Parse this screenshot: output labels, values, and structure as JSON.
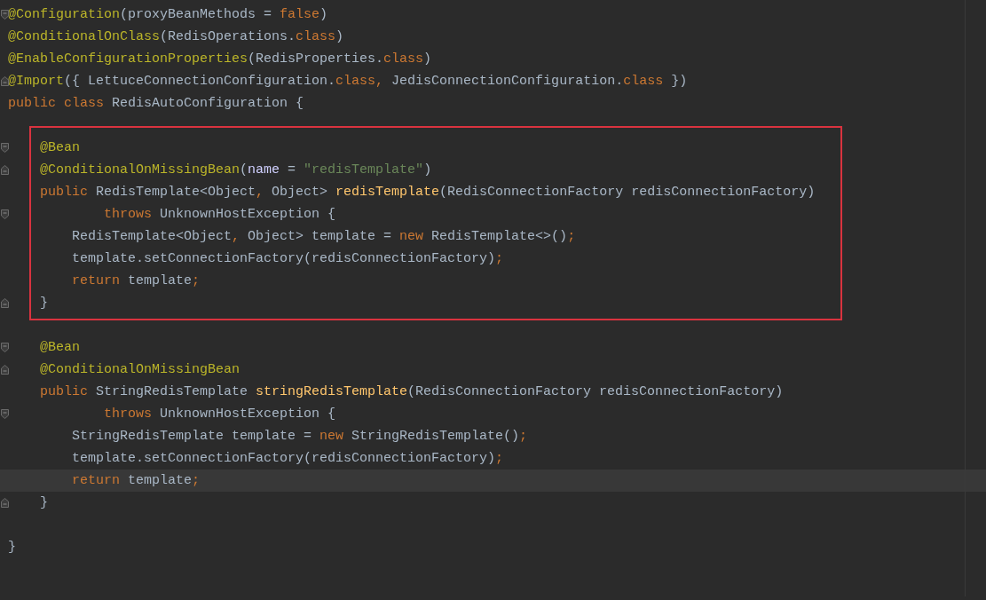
{
  "editor": {
    "lines": [
      {
        "kind": "code",
        "current": false,
        "fold": {
          "kind": "open"
        },
        "tokens": [
          {
            "kind": "annotation",
            "text": "@Configuration"
          },
          {
            "kind": "plain",
            "text": "(proxyBeanMethods = "
          },
          {
            "kind": "keyword",
            "text": "false"
          },
          {
            "kind": "plain",
            "text": ")"
          }
        ]
      },
      {
        "kind": "code",
        "current": false,
        "tokens": [
          {
            "kind": "annotation",
            "text": "@ConditionalOnClass"
          },
          {
            "kind": "plain",
            "text": "(RedisOperations."
          },
          {
            "kind": "keyword",
            "text": "class"
          },
          {
            "kind": "plain",
            "text": ")"
          }
        ]
      },
      {
        "kind": "code",
        "current": false,
        "tokens": [
          {
            "kind": "annotation",
            "text": "@EnableConfigurationProperties"
          },
          {
            "kind": "plain",
            "text": "(RedisProperties."
          },
          {
            "kind": "keyword",
            "text": "class"
          },
          {
            "kind": "plain",
            "text": ")"
          }
        ]
      },
      {
        "kind": "code",
        "current": false,
        "fold": {
          "kind": "close"
        },
        "tokens": [
          {
            "kind": "annotation",
            "text": "@Import"
          },
          {
            "kind": "plain",
            "text": "({ LettuceConnectionConfiguration."
          },
          {
            "kind": "keyword",
            "text": "class,"
          },
          {
            "kind": "plain",
            "text": " JedisConnectionConfiguration."
          },
          {
            "kind": "keyword",
            "text": "class"
          },
          {
            "kind": "plain",
            "text": " })"
          }
        ]
      },
      {
        "kind": "code",
        "current": false,
        "tokens": [
          {
            "kind": "keyword",
            "text": "public class "
          },
          {
            "kind": "plain",
            "text": "RedisAutoConfiguration {"
          }
        ],
        "children": [
          {
            "kind": "highlight",
            "children": [
              {
                "kind": "code",
                "current": false,
                "fold": {
                  "kind": "open"
                },
                "tokens": [
                  {
                    "kind": "annotation",
                    "text": "@Bean"
                  }
                ]
              },
              {
                "kind": "code",
                "current": false,
                "fold": {
                  "kind": "close"
                },
                "tokens": [
                  {
                    "kind": "annotation",
                    "text": "@ConditionalOnMissingBean"
                  },
                  {
                    "kind": "plain",
                    "text": "("
                  },
                  {
                    "kind": "param",
                    "text": "name"
                  },
                  {
                    "kind": "plain",
                    "text": " = "
                  },
                  {
                    "kind": "string",
                    "text": "\"redisTemplate\""
                  },
                  {
                    "kind": "plain",
                    "text": ")"
                  }
                ]
              },
              {
                "kind": "code",
                "current": false,
                "tokens": [
                  {
                    "kind": "keyword",
                    "text": "public "
                  },
                  {
                    "kind": "plain",
                    "text": "RedisTemplate<Object"
                  },
                  {
                    "kind": "keyword",
                    "text": ","
                  },
                  {
                    "kind": "plain",
                    "text": " Object> "
                  },
                  {
                    "kind": "method",
                    "text": "redisTemplate"
                  },
                  {
                    "kind": "plain",
                    "text": "(RedisConnectionFactory redisConnectionFactory)"
                  }
                ],
                "children": [
                  {
                    "kind": "continuation",
                    "current": false,
                    "fold": {
                      "kind": "open"
                    },
                    "tokens": [
                      {
                        "kind": "keyword",
                        "text": "throws "
                      },
                      {
                        "kind": "plain",
                        "text": "UnknownHostException {"
                      }
                    ]
                  },
                  {
                    "kind": "code",
                    "current": false,
                    "tokens": [
                      {
                        "kind": "plain",
                        "text": "RedisTemplate<Object"
                      },
                      {
                        "kind": "keyword",
                        "text": ","
                      },
                      {
                        "kind": "plain",
                        "text": " Object> template = "
                      },
                      {
                        "kind": "keyword",
                        "text": "new "
                      },
                      {
                        "kind": "plain",
                        "text": "RedisTemplate<>()"
                      },
                      {
                        "kind": "keyword",
                        "text": ";"
                      }
                    ]
                  },
                  {
                    "kind": "code",
                    "current": false,
                    "tokens": [
                      {
                        "kind": "plain",
                        "text": "template.setConnectionFactory(redisConnectionFactory)"
                      },
                      {
                        "kind": "keyword",
                        "text": ";"
                      }
                    ]
                  },
                  {
                    "kind": "code",
                    "current": false,
                    "tokens": [
                      {
                        "kind": "keyword",
                        "text": "return "
                      },
                      {
                        "kind": "plain",
                        "text": "template"
                      },
                      {
                        "kind": "keyword",
                        "text": ";"
                      }
                    ]
                  }
                ]
              },
              {
                "kind": "code",
                "current": false,
                "fold": {
                  "kind": "close"
                },
                "tokens": [
                  {
                    "kind": "plain",
                    "text": "}"
                  }
                ]
              }
            ]
          },
          {
            "kind": "code",
            "current": false,
            "fold": {
              "kind": "open"
            },
            "tokens": [
              {
                "kind": "annotation",
                "text": "@Bean"
              }
            ]
          },
          {
            "kind": "code",
            "current": false,
            "fold": {
              "kind": "close"
            },
            "tokens": [
              {
                "kind": "annotation",
                "text": "@ConditionalOnMissingBean"
              }
            ]
          },
          {
            "kind": "code",
            "current": false,
            "tokens": [
              {
                "kind": "keyword",
                "text": "public "
              },
              {
                "kind": "plain",
                "text": "StringRedisTemplate "
              },
              {
                "kind": "method",
                "text": "stringRedisTemplate"
              },
              {
                "kind": "plain",
                "text": "(RedisConnectionFactory redisConnectionFactory)"
              }
            ],
            "children": [
              {
                "kind": "continuation",
                "current": false,
                "fold": {
                  "kind": "open"
                },
                "tokens": [
                  {
                    "kind": "keyword",
                    "text": "throws "
                  },
                  {
                    "kind": "plain",
                    "text": "UnknownHostException {"
                  }
                ]
              },
              {
                "kind": "code",
                "current": false,
                "tokens": [
                  {
                    "kind": "plain",
                    "text": "StringRedisTemplate template = "
                  },
                  {
                    "kind": "keyword",
                    "text": "new "
                  },
                  {
                    "kind": "plain",
                    "text": "StringRedisTemplate()"
                  },
                  {
                    "kind": "keyword",
                    "text": ";"
                  }
                ]
              },
              {
                "kind": "code",
                "current": false,
                "tokens": [
                  {
                    "kind": "plain",
                    "text": "template.setConnectionFactory(redisConnectionFactory)"
                  },
                  {
                    "kind": "keyword",
                    "text": ";"
                  }
                ]
              },
              {
                "kind": "code",
                "current": true,
                "tokens": [
                  {
                    "kind": "keyword",
                    "text": "return "
                  },
                  {
                    "kind": "plain",
                    "text": "template"
                  },
                  {
                    "kind": "keyword",
                    "text": ";"
                  }
                ]
              }
            ]
          },
          {
            "kind": "code",
            "current": false,
            "fold": {
              "kind": "close"
            },
            "tokens": [
              {
                "kind": "plain",
                "text": "}"
              }
            ]
          },
          {
            "kind": "blank",
            "current": false
          }
        ]
      },
      {
        "kind": "code",
        "current": false,
        "tokens": [
          {
            "kind": "plain",
            "text": "}"
          }
        ]
      }
    ]
  }
}
